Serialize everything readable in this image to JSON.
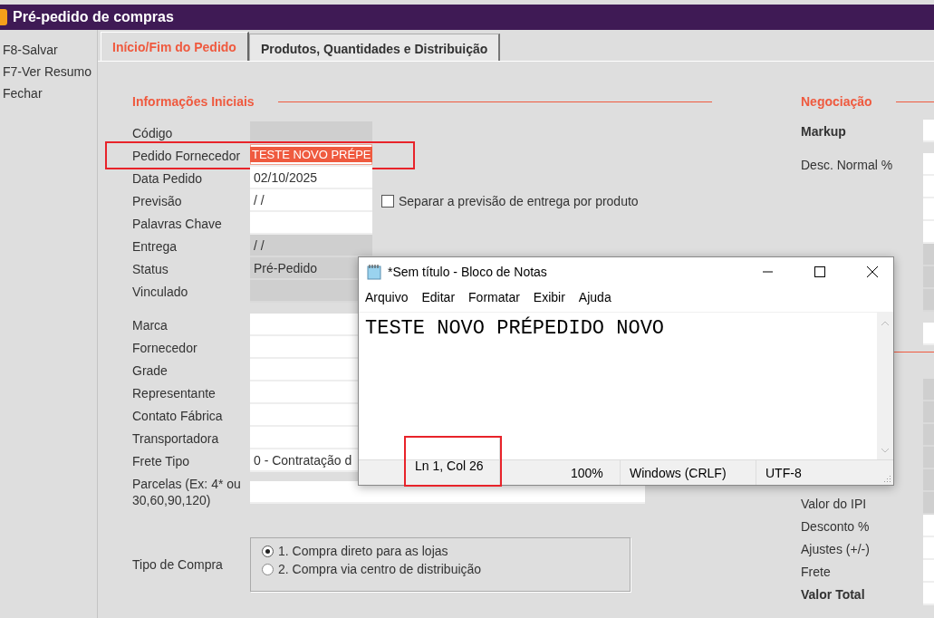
{
  "window": {
    "title": "Pré-pedido de compras"
  },
  "sidebar": {
    "items": [
      "F8-Salvar",
      "F7-Ver Resumo",
      "Fechar"
    ]
  },
  "tabs": [
    {
      "label": "Início/Fim do Pedido",
      "selected": true
    },
    {
      "label": "Produtos, Quantidades e Distribuição",
      "selected": false
    }
  ],
  "initial_info": {
    "title": "Informações Iniciais",
    "fields": [
      {
        "label": "Código",
        "disabled": true,
        "selected": false,
        "highlighted": false
      },
      {
        "label": "Pedido Fornecedor",
        "value": "TESTE NOVO PRÉPE",
        "disabled": false,
        "selected": true,
        "highlighted": true
      },
      {
        "label": "Data Pedido",
        "value": "02/10/2025",
        "disabled": false,
        "selected": false,
        "highlighted": false
      },
      {
        "label": "Previsão",
        "value": "/  /",
        "disabled": false,
        "selected": false,
        "highlighted": false,
        "checkbox": {
          "label": "Separar a previsão de entrega por produto",
          "checked": false
        }
      },
      {
        "label": "Palavras Chave",
        "disabled": false,
        "selected": false,
        "highlighted": false
      },
      {
        "label": "Entrega",
        "value": "/  /",
        "disabled": true,
        "selected": false,
        "highlighted": false
      },
      {
        "label": "Status",
        "value": "Pré-Pedido",
        "disabled": true,
        "selected": false,
        "highlighted": false
      },
      {
        "label": "Vinculado",
        "disabled": true,
        "selected": false,
        "highlighted": false
      }
    ],
    "fields_2": [
      {
        "label": "Marca"
      },
      {
        "label": "Fornecedor"
      },
      {
        "label": "Grade"
      },
      {
        "label": "Representante"
      },
      {
        "label": "Contato Fábrica"
      },
      {
        "label": "Transportadora"
      },
      {
        "label": "Frete Tipo",
        "value": "0 - Contratação d"
      }
    ],
    "installments": {
      "label": "Parcelas (Ex: 4* ou 30,60,90,120)"
    },
    "purchase_type": {
      "label": "Tipo de Compra",
      "options": [
        {
          "label": "1. Compra direto para as lojas",
          "selected": true
        },
        {
          "label": "2. Compra via centro de distribuição",
          "selected": false
        }
      ]
    }
  },
  "negotiation": {
    "title": "Negociação",
    "rows": [
      {
        "label": "Markup",
        "bold": true,
        "disabled": false
      },
      {
        "label": "Desc. Normal %",
        "bold": false,
        "disabled": false
      },
      {
        "disabled": false
      },
      {
        "disabled": false
      },
      {
        "disabled": false
      },
      {
        "disabled": true
      },
      {
        "disabled": true
      },
      {
        "disabled": true
      },
      {
        "disabled": false
      }
    ],
    "totals": [
      {
        "disabled": true
      },
      {
        "disabled": true
      },
      {
        "disabled": true
      },
      {
        "disabled": true
      },
      {
        "disabled": true
      },
      {
        "label": "Valor do IPI",
        "bold": false,
        "disabled": true
      },
      {
        "label": "Desconto %",
        "bold": false,
        "disabled": false
      },
      {
        "label": "Ajustes (+/-)",
        "bold": false,
        "disabled": false
      },
      {
        "label": "Frete",
        "bold": false,
        "disabled": false
      },
      {
        "label": "Valor Total",
        "bold": true,
        "disabled": false
      }
    ]
  },
  "notepad": {
    "title": "*Sem título - Bloco de Notas",
    "menu": [
      "Arquivo",
      "Editar",
      "Formatar",
      "Exibir",
      "Ajuda"
    ],
    "text": "TESTE NOVO PRÉPEDIDO NOVO",
    "status_bar": [
      {
        "text": "Ln 1, Col 26",
        "highlighted": true
      },
      {
        "text": "100%",
        "highlighted": false
      },
      {
        "text": "Windows (CRLF)",
        "highlighted": false
      },
      {
        "text": "UTF-8",
        "highlighted": false
      }
    ]
  }
}
